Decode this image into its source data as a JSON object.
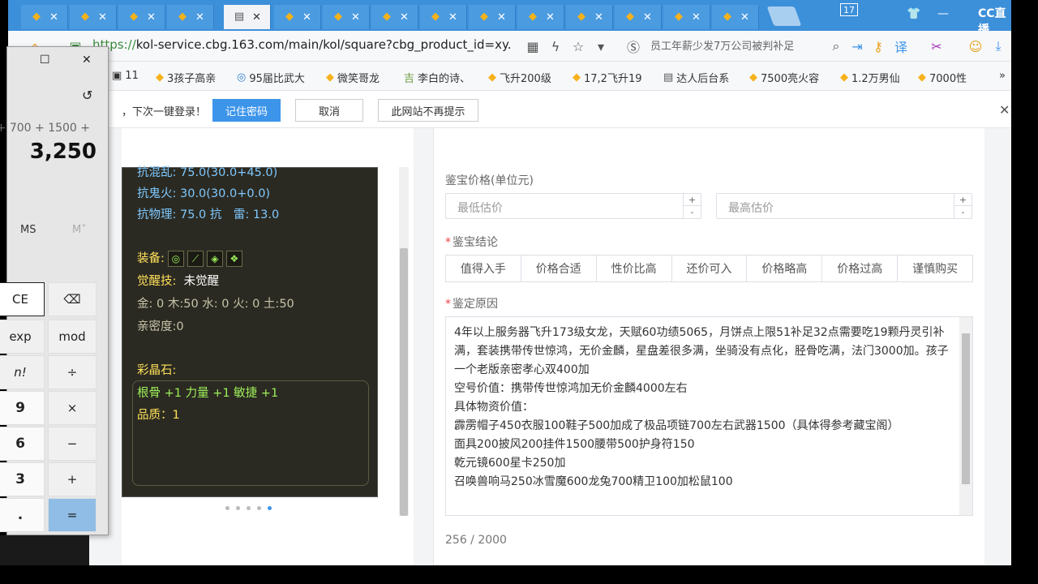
{
  "browser": {
    "tabs_count_label": "",
    "url": {
      "proto": "https://",
      "rest": "kol-service.cbg.163.com/main/kol/square?cbg_product_id=xy."
    },
    "search_suggestion": "员工年薪少发7万公司被判补足",
    "window_badge": "17",
    "logo_text": "CC直播"
  },
  "bookmarks": [
    {
      "label": "11"
    },
    {
      "label": "3孩子高亲"
    },
    {
      "label": "95届比武大"
    },
    {
      "label": "微笑哥龙"
    },
    {
      "label": "李白的诗、"
    },
    {
      "label": "飞升200级"
    },
    {
      "label": "17,2飞升19"
    },
    {
      "label": "达人后台系"
    },
    {
      "label": "7500亮火容"
    },
    {
      "label": "1.2万男仙"
    },
    {
      "label": "7000性"
    }
  ],
  "password_bar": {
    "text": "，下次一键登录！",
    "save": "记住密码",
    "cancel": "取消",
    "never": "此网站不再提示"
  },
  "game_card": {
    "line_top_partial": "抗混乱: 75.0(30.0+45.0)",
    "resist_ghost_fire": "抗鬼火: 30.0(30.0+0.0)",
    "resist_physical": "抗物理: 75.0 抗　雷: 13.0",
    "equip_label": "装备:",
    "awaken_label": "觉醒技:",
    "awaken_value": "未觉醒",
    "elements": "金: 0 木:50 水: 0 火: 0 土:50",
    "intimacy": "亲密度:0",
    "crystal_label": "彩晶石:",
    "crystal_value": "根骨 +1 力量 +1 敏捷 +1",
    "quality": "品质：1"
  },
  "form": {
    "price_label": "鉴宝价格(单位元)",
    "min_placeholder": "最低估价",
    "max_placeholder": "最高估价",
    "conclusion_label": "鉴宝结论",
    "options": [
      "值得入手",
      "价格合适",
      "性价比高",
      "还价可入",
      "价格略高",
      "价格过高",
      "谨慎购买"
    ],
    "reason_label": "鉴定原因",
    "reason_lines": [
      "4年以上服务器飞升173级女龙，天赋60功绩5065，月饼点上限51补足32点需要吃19颗丹灵引补满，套装携带传世惊鸿，无价金麟，星盘差很多满，坐骑没有点化，胫骨吃满，法门3000加。孩子一个老版亲密孝心双400加",
      "空号价值：携带传世惊鸿加无价金麟4000左右",
      "具体物资价值：",
      "霹雳帽子450衣服100鞋子500加成了极品项链700左右武器1500（具体得参考藏宝阁）",
      "面具200披风200挂件1500腰带500护身符150",
      "乾元镜600星卡250加",
      "召唤兽响马250冰雪魔600龙兔700精卫100加松鼠100"
    ],
    "counter": "256 / 2000"
  },
  "calculator": {
    "expression": "+ 700 + 1500 +",
    "result": "3,250",
    "ms": "MS",
    "mplus": "M˅",
    "keys": {
      "ce": "CE",
      "back": "⌫",
      "exp": "exp",
      "mod": "mod",
      "fact": "n!",
      "div": "÷",
      "nine": "9",
      "mul": "×",
      "six": "6",
      "minus": "−",
      "three": "3",
      "plus": "+",
      "dot": ".",
      "eq": "="
    }
  }
}
